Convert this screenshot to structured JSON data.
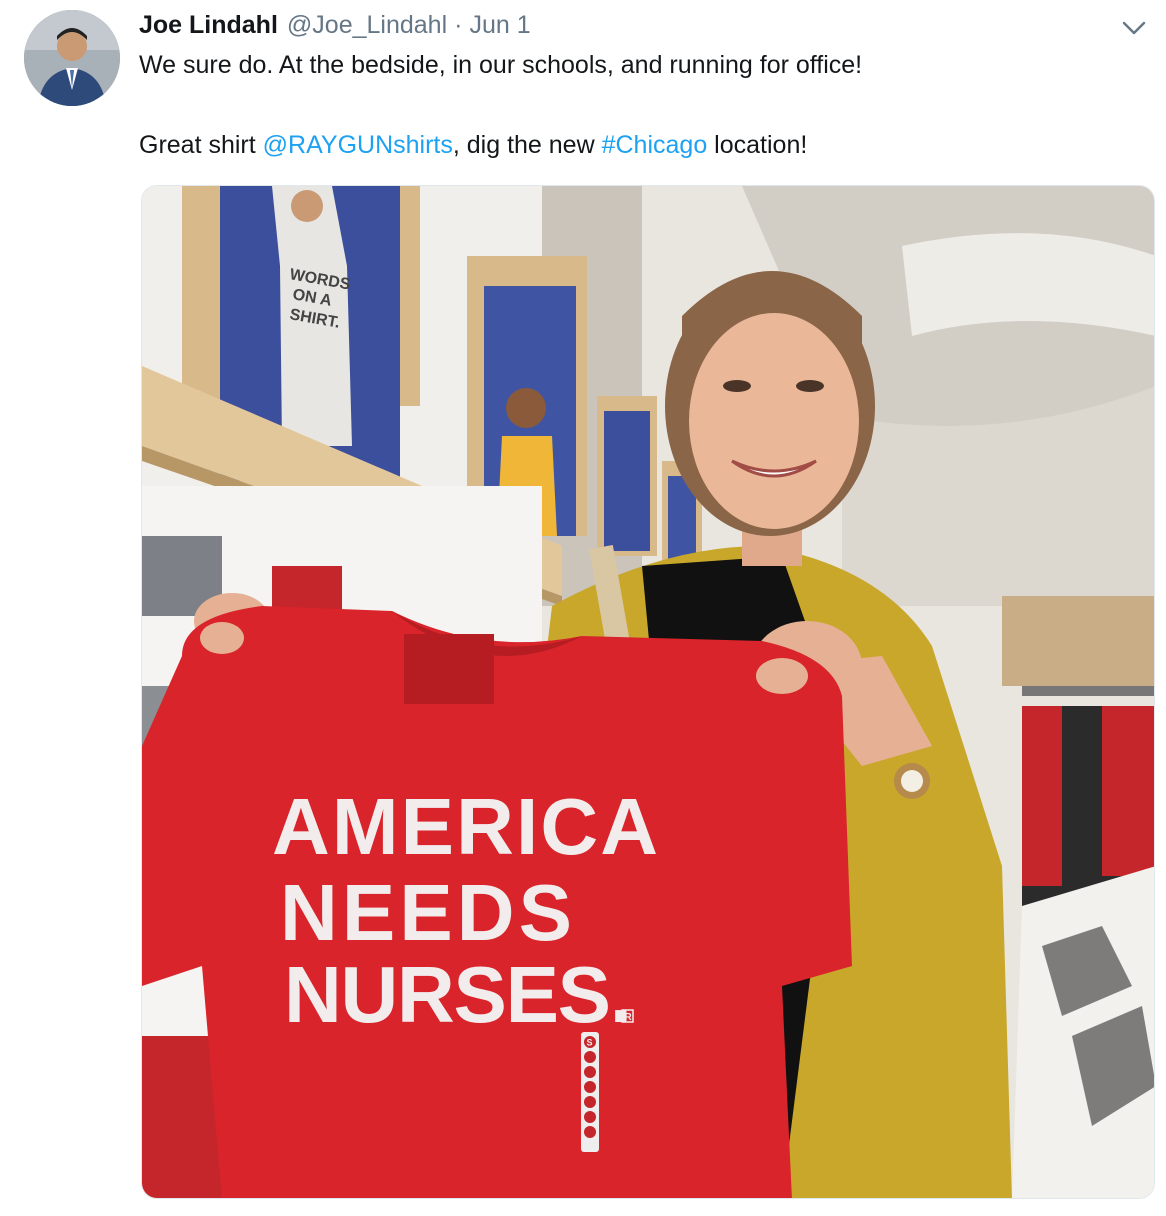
{
  "tweet": {
    "author": {
      "display_name": "Joe Lindahl",
      "handle": "@Joe_Lindahl",
      "avatar_icon": "user-avatar"
    },
    "separator": "·",
    "timestamp": "Jun 1",
    "menu_icon": "chevron-down-icon",
    "text": {
      "line1": "We sure do. At the bedside, in our schools, and running for office!",
      "line2_prefix": "Great shirt ",
      "mention": "@RAYGUNshirts",
      "line2_middle": ", dig the new ",
      "hashtag": "#Chicago",
      "line2_suffix": " location!"
    },
    "media": {
      "shirt_lines": [
        "AMERICA",
        "NEEDS",
        "NURSES."
      ],
      "shirt_mark": "R",
      "poster_lines": [
        "WORDS",
        "ON A",
        "SHIRT."
      ],
      "size_sticker": "S"
    },
    "colors": {
      "link": "#1da1f2",
      "secondary_text": "#657786",
      "shirt_red": "#d8242a",
      "cardigan": "#c9a72a"
    }
  }
}
